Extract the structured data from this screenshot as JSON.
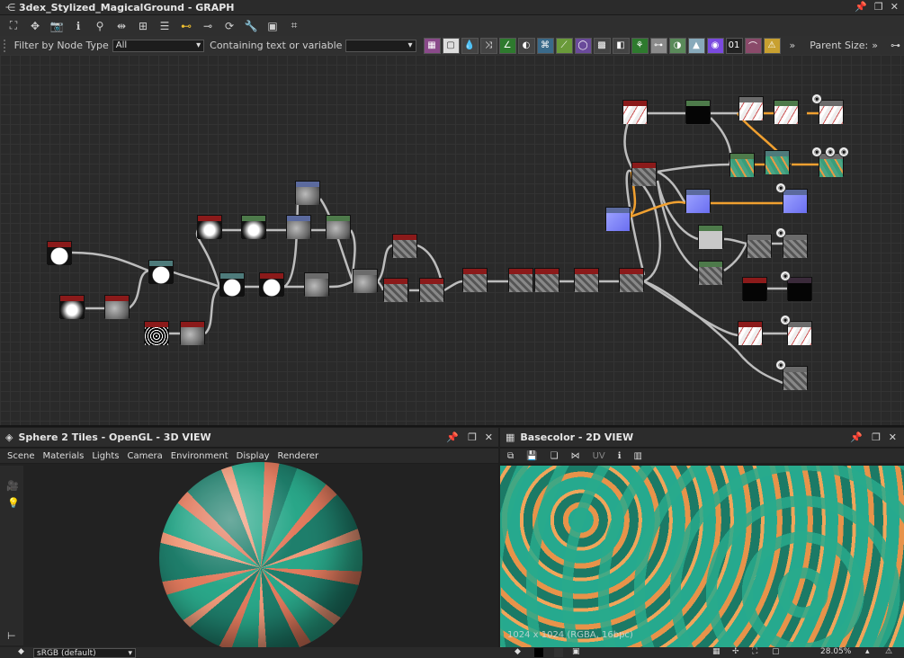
{
  "window": {
    "title": "3dex_Stylized_MagicalGround - GRAPH"
  },
  "toolbar1": {
    "icons": [
      "frame-icon",
      "pan-icon",
      "camera-icon",
      "info-icon",
      "search-icon",
      "link-icon",
      "hierarchy-icon",
      "list-icon",
      "connector-icon",
      "graph-icon",
      "refresh-icon",
      "tools-icon",
      "screenshot-icon",
      "crop-icon"
    ]
  },
  "filterbar": {
    "filter_label": "Filter by Node Type",
    "filter_value": "All",
    "containing_label": "Containing text or variable",
    "containing_value": "",
    "more": "»",
    "parent_size_label": "Parent Size:",
    "parent_size_more": "»"
  },
  "view3d": {
    "title": "Sphere 2 Tiles - OpenGL - 3D VIEW",
    "menu": [
      "Scene",
      "Materials",
      "Lights",
      "Camera",
      "Environment",
      "Display",
      "Renderer"
    ],
    "colorspace": "sRGB (default)"
  },
  "view2d": {
    "title": "Basecolor - 2D VIEW",
    "uv_label": "UV",
    "info": "1024 x 1024 (RGBA, 16bpc)",
    "zoom": "28.05%"
  },
  "colors": {
    "accent_orange": "#f0a030",
    "teal": "#2aa88a",
    "node_red": "#8b1a1a",
    "node_green": "#4d7a4a"
  }
}
